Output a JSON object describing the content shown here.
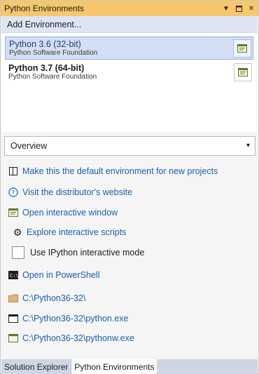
{
  "window": {
    "title": "Python Environments"
  },
  "add_environment": {
    "label": "Add Environment..."
  },
  "environments": [
    {
      "name": "Python 3.6 (32-bit)",
      "publisher": "Python Software Foundation",
      "selected": true
    },
    {
      "name": "Python 3.7 (64-bit)",
      "publisher": "Python Software Foundation",
      "selected": false
    }
  ],
  "view_select": {
    "value": "Overview"
  },
  "actions": {
    "make_default": "Make this the default environment for new projects",
    "visit_site": "Visit the distributor's website",
    "open_interactive": "Open interactive window",
    "explore_scripts": "Explore interactive scripts",
    "use_ipython": "Use IPython interactive mode",
    "open_powershell": "Open in PowerShell"
  },
  "paths": {
    "folder": "C:\\Python36-32\\",
    "python_exe": "C:\\Python36-32\\python.exe",
    "pythonw_exe": "C:\\Python36-32\\pythonw.exe"
  },
  "tabs": [
    "Solution Explorer",
    "Python Environments"
  ],
  "colors": {
    "titlebar": "#f6c76b",
    "link": "#1a5fb4",
    "selection": "#d4dff5"
  }
}
